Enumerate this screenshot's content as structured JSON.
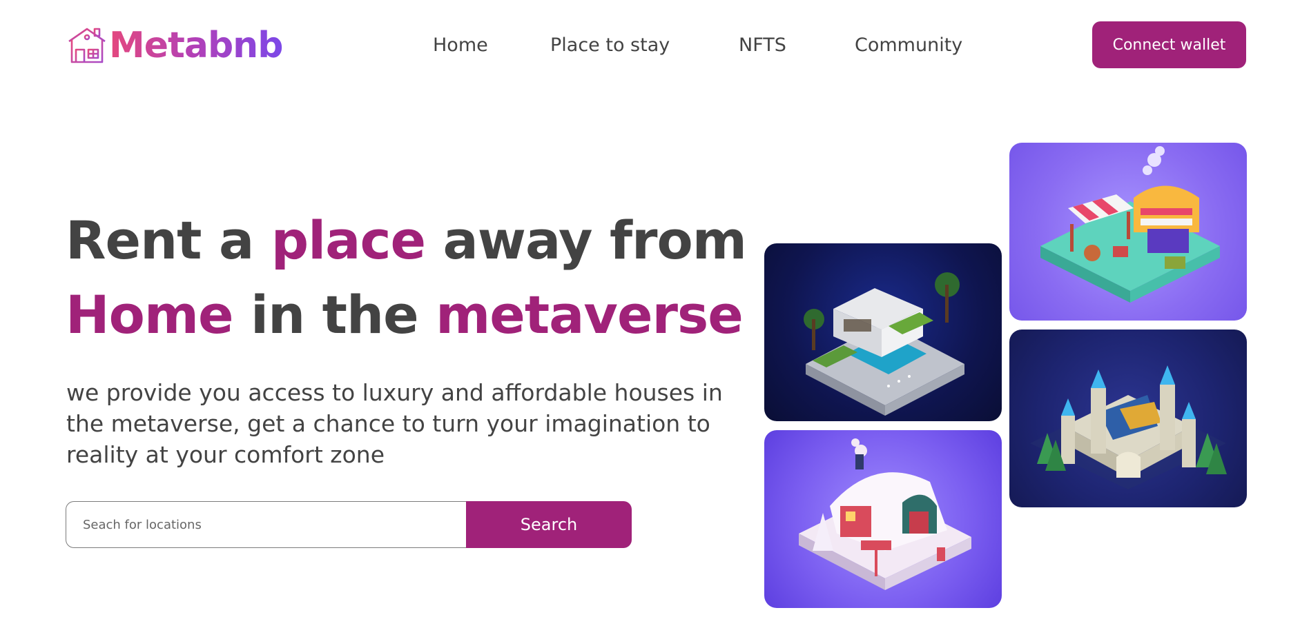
{
  "brand": {
    "name": "Metabnb",
    "logo_icon": "house-icon",
    "gradient": [
      "#e4487e",
      "#b140b8",
      "#7c48e8"
    ]
  },
  "nav": {
    "items": [
      "Home",
      "Place to stay",
      "NFTS",
      "Community"
    ]
  },
  "header": {
    "connect_label": "Connect wallet"
  },
  "hero": {
    "title_line1": {
      "a": "Rent a ",
      "b": "place",
      "c": " away from"
    },
    "title_line2": {
      "a": "Home",
      "b": " in the ",
      "c": "metaverse"
    },
    "description": "we provide you access to luxury and affordable houses in the metaverse, get a chance to turn your imagination to reality at your comfort zone"
  },
  "search": {
    "placeholder": "Seach for locations",
    "button_label": "Search"
  },
  "cards": [
    {
      "name": "modern-villa-with-pool"
    },
    {
      "name": "market-stalls"
    },
    {
      "name": "castle-with-forest"
    },
    {
      "name": "snowy-cottage"
    }
  ],
  "colors": {
    "accent": "#a02279",
    "text": "#434343"
  }
}
